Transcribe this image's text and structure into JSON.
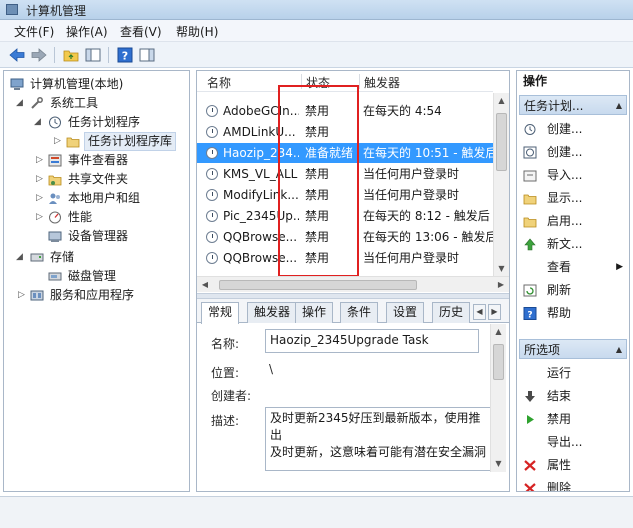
{
  "window": {
    "title": "计算机管理"
  },
  "menu": [
    "文件(F)",
    "操作(A)",
    "查看(V)",
    "帮助(H)"
  ],
  "tree": {
    "root": "计算机管理(本地)",
    "system_tools": "系统工具",
    "task_scheduler": "任务计划程序",
    "task_library": "任务计划程序库",
    "event_viewer": "事件查看器",
    "shared_folders": "共享文件夹",
    "local_users": "本地用户和组",
    "performance": "性能",
    "device_manager": "设备管理器",
    "storage": "存储",
    "disk_management": "磁盘管理",
    "services_apps": "服务和应用程序"
  },
  "task_list": {
    "headers": {
      "name": "名称",
      "status": "状态",
      "trigger": "触发器"
    },
    "rows": [
      {
        "name": "AdobeGCIn...",
        "status": "禁用",
        "trigger": "在每天的 4:54"
      },
      {
        "name": "AMDLinkU...",
        "status": "禁用",
        "trigger": ""
      },
      {
        "name": "Haozip_234...",
        "status": "准备就绪",
        "trigger": "在每天的 10:51 - 触发后"
      },
      {
        "name": "KMS_VL_ALL",
        "status": "禁用",
        "trigger": "当任何用户登录时"
      },
      {
        "name": "ModifyLink...",
        "status": "禁用",
        "trigger": "当任何用户登录时"
      },
      {
        "name": "Pic_2345Up...",
        "status": "禁用",
        "trigger": "在每天的 8:12 - 触发后"
      },
      {
        "name": "QQBrowse...",
        "status": "禁用",
        "trigger": "在每天的 13:06 - 触发后"
      },
      {
        "name": "QQBrowse...",
        "status": "禁用",
        "trigger": "当任何用户登录时"
      }
    ]
  },
  "tabs": [
    "常规",
    "触发器",
    "操作",
    "条件",
    "设置",
    "历史"
  ],
  "detail": {
    "name_label": "名称:",
    "name_value": "Haozip_2345Upgrade Task",
    "location_label": "位置:",
    "location_value": "\\",
    "author_label": "创建者:",
    "author_value": "",
    "desc_label": "描述:",
    "desc_value_line1": "及时更新2345好压到最新版本，使用推出",
    "desc_value_line2": "及时更新，这意味着可能有潜在安全漏洞"
  },
  "actions": {
    "title": "操作",
    "section1": "任务计划...",
    "items1": [
      "创建...",
      "创建...",
      "导入...",
      "显示...",
      "启用...",
      "新文...",
      "查看",
      "刷新",
      "帮助"
    ],
    "section2": "所选项",
    "items2": [
      "运行",
      "结束",
      "禁用",
      "导出...",
      "属性",
      "删除"
    ]
  },
  "colors": {
    "selection": "#3399ff",
    "highlight_box": "#e02020"
  }
}
